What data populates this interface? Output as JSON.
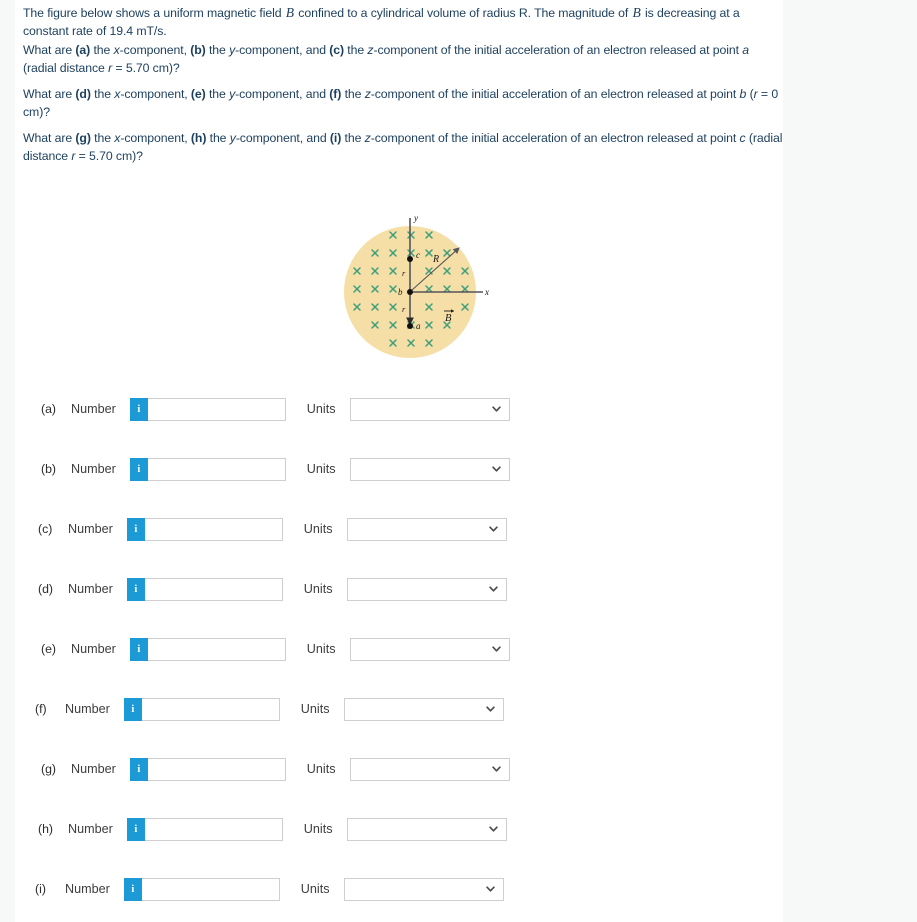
{
  "problem": {
    "paragraphs": [
      {
        "id": "intro",
        "text": "The figure below shows a uniform magnetic field  B  confined to a cylindrical volume of radius R. The magnitude of  B  is decreasing at a constant rate of 19.4 mT/s."
      },
      {
        "id": "q-abc",
        "text": "What are (a) the x-component, (b) the y-component, and (c) the z-component of the initial acceleration of an electron released at point a (radial distance r = 5.70 cm)?"
      },
      {
        "id": "q-def",
        "text": "What are (d) the x-component, (e) the y-component, and (f) the z-component of the initial acceleration of an electron released at point b (r = 0 cm)?"
      },
      {
        "id": "q-ghi",
        "text": "What are (g) the x-component, (h) the y-component, and (i) the z-component of the initial acceleration of an electron released at point c (radial distance r = 5.70 cm)?"
      }
    ],
    "values": {
      "dBdt": "19.4 mT/s",
      "r_a": "5.70 cm",
      "r_b": "0 cm",
      "r_c": "5.70 cm"
    }
  },
  "figure": {
    "name": "magnetic-field-cylinder-diagram",
    "axis_x_label": "x",
    "axis_y_label": "y",
    "radius_label": "R",
    "field_label": "B",
    "point_labels": [
      "a",
      "b",
      "c"
    ],
    "distance_labels": [
      "r",
      "r"
    ],
    "field_symbol": "×",
    "field_direction": "into-page",
    "colors": {
      "disk_fill": "#f6dfa6",
      "cross_marks": "#3f9e7c",
      "axis": "#55555a",
      "point": "#111111"
    }
  },
  "answers": {
    "number_label": "Number",
    "units_label": "Units",
    "info_glyph": "i",
    "input_value": "",
    "input_placeholder": "",
    "select_value": "",
    "rows": [
      {
        "letter": "(a)",
        "key": "a"
      },
      {
        "letter": "(b)",
        "key": "b"
      },
      {
        "letter": "(c)",
        "key": "c"
      },
      {
        "letter": "(d)",
        "key": "d"
      },
      {
        "letter": "(e)",
        "key": "e"
      },
      {
        "letter": "(f)",
        "key": "f"
      },
      {
        "letter": "(g)",
        "key": "g"
      },
      {
        "letter": "(h)",
        "key": "h"
      },
      {
        "letter": "(i)",
        "key": "i"
      }
    ]
  },
  "theme": {
    "page_background": "#f7f8f8",
    "card_background": "#ffffff",
    "text_color": "#1c3f5e",
    "accent_blue": "#1b9ad6",
    "border_gray": "#cfcfcf"
  }
}
